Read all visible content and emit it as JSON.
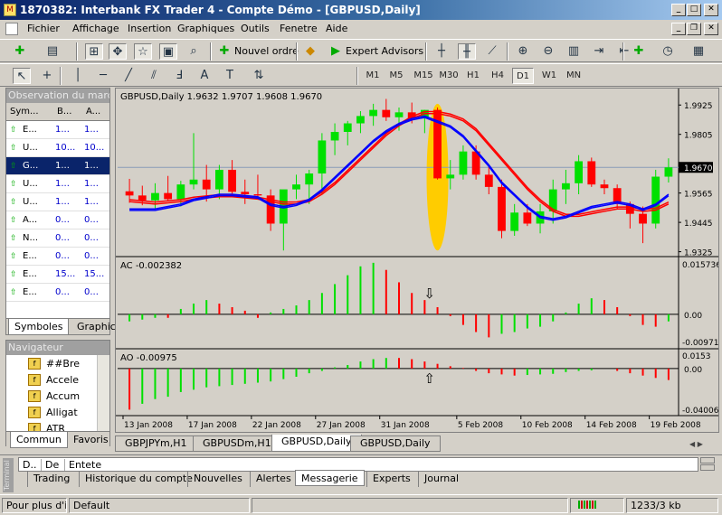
{
  "window": {
    "title": "1870382: Interbank FX Trader 4 - Compte Démo - [GBPUSD,Daily]"
  },
  "menu": [
    "Fichier",
    "Affichage",
    "Insertion",
    "Graphiques",
    "Outils",
    "Fenetre",
    "Aide"
  ],
  "toolbar": {
    "new_order": "Nouvel ordre",
    "expert_advisors": "Expert Advisors"
  },
  "timeframes": [
    "M1",
    "M5",
    "M15",
    "M30",
    "H1",
    "H4",
    "D1",
    "W1",
    "MN"
  ],
  "timeframe_selected": "D1",
  "market_watch": {
    "title": "Observation du marché",
    "columns": [
      "Sym...",
      "B...",
      "A..."
    ],
    "rows": [
      {
        "symbol": "E...",
        "bid": "1...",
        "ask": "1..."
      },
      {
        "symbol": "U...",
        "bid": "10...",
        "ask": "10..."
      },
      {
        "symbol": "G...",
        "bid": "1...",
        "ask": "1...",
        "selected": true
      },
      {
        "symbol": "U...",
        "bid": "1...",
        "ask": "1..."
      },
      {
        "symbol": "U...",
        "bid": "1...",
        "ask": "1..."
      },
      {
        "symbol": "A...",
        "bid": "0...",
        "ask": "0..."
      },
      {
        "symbol": "N...",
        "bid": "0...",
        "ask": "0..."
      },
      {
        "symbol": "E...",
        "bid": "0...",
        "ask": "0..."
      },
      {
        "symbol": "E...",
        "bid": "15...",
        "ask": "15..."
      },
      {
        "symbol": "E...",
        "bid": "0...",
        "ask": "0..."
      }
    ],
    "tabs": [
      "Symboles",
      "Graphic"
    ]
  },
  "navigator": {
    "title": "Navigateur",
    "items": [
      "##Bre",
      "Accele",
      "Accum",
      "Alligat",
      "ATR"
    ],
    "tabs": [
      "Commun",
      "Favoris"
    ]
  },
  "chart": {
    "header": "GBPUSD,Daily  1.9632 1.9707 1.9608 1.9670",
    "price_ticks": [
      "1.9925",
      "1.9805",
      "1.9565",
      "1.9445",
      "1.9325"
    ],
    "current_price": "1.9670",
    "ac_label": "AC -0.002382",
    "ac_ticks": [
      "0.015736",
      "0.00",
      "-0.00971"
    ],
    "ao_label": "AO -0.00975",
    "ao_ticks": [
      "0.0153",
      "0.00",
      "-0.04006"
    ],
    "dates": [
      "13 Jan 2008",
      "17 Jan 2008",
      "22 Jan 2008",
      "27 Jan 2008",
      "31 Jan 2008",
      "5 Feb 2008",
      "10 Feb 2008",
      "14 Feb 2008",
      "19 Feb 2008"
    ],
    "colors": {
      "up": "#00e000",
      "down": "#ff0000",
      "bg": "#d4d0c8",
      "ma_fast": "#0000ff",
      "ma_slow": "#ff0000",
      "highlight": "#ffcc00"
    }
  },
  "chart_data": {
    "type": "candlestick",
    "ohlc": [
      [
        1.9572,
        1.9623,
        1.9525,
        1.9555
      ],
      [
        1.9555,
        1.9595,
        1.9515,
        1.9535
      ],
      [
        1.9535,
        1.9605,
        1.95,
        1.9565
      ],
      [
        1.9565,
        1.9635,
        1.9535,
        1.954
      ],
      [
        1.954,
        1.9615,
        1.951,
        1.96
      ],
      [
        1.96,
        1.981,
        1.958,
        1.962
      ],
      [
        1.962,
        1.968,
        1.953,
        1.958
      ],
      [
        1.958,
        1.968,
        1.954,
        1.966
      ],
      [
        1.966,
        1.97,
        1.956,
        1.957
      ],
      [
        1.957,
        1.962,
        1.952,
        1.956
      ],
      [
        1.956,
        1.964,
        1.954,
        1.9555
      ],
      [
        1.9555,
        1.958,
        1.941,
        1.944
      ],
      [
        1.944,
        1.956,
        1.933,
        1.958
      ],
      [
        1.958,
        1.964,
        1.954,
        1.96
      ],
      [
        1.96,
        1.966,
        1.952,
        1.9645
      ],
      [
        1.9645,
        1.981,
        1.956,
        1.978
      ],
      [
        1.978,
        1.985,
        1.972,
        1.9815
      ],
      [
        1.9815,
        1.986,
        1.976,
        1.985
      ],
      [
        1.985,
        1.99,
        1.981,
        1.988
      ],
      [
        1.988,
        1.993,
        1.984,
        1.9905
      ],
      [
        1.9905,
        1.995,
        1.986,
        1.9875
      ],
      [
        1.9875,
        1.9915,
        1.982,
        1.9895
      ],
      [
        1.9895,
        1.9935,
        1.985,
        1.987
      ],
      [
        1.987,
        1.9905,
        1.981,
        1.9905
      ],
      [
        1.9905,
        1.9915,
        1.962,
        1.9625
      ],
      [
        1.9625,
        1.97,
        1.958,
        1.964
      ],
      [
        1.964,
        1.976,
        1.962,
        1.9735
      ],
      [
        1.9735,
        1.976,
        1.962,
        1.964
      ],
      [
        1.964,
        1.968,
        1.956,
        1.959
      ],
      [
        1.959,
        1.962,
        1.938,
        1.941
      ],
      [
        1.941,
        1.952,
        1.939,
        1.9485
      ],
      [
        1.9485,
        1.952,
        1.943,
        1.944
      ],
      [
        1.944,
        1.952,
        1.94,
        1.949
      ],
      [
        1.949,
        1.962,
        1.944,
        1.958
      ],
      [
        1.958,
        1.966,
        1.952,
        1.9605
      ],
      [
        1.9605,
        1.972,
        1.956,
        1.9695
      ],
      [
        1.9695,
        1.971,
        1.959,
        1.96
      ],
      [
        1.96,
        1.962,
        1.956,
        1.9585
      ],
      [
        1.9585,
        1.96,
        1.95,
        1.952
      ],
      [
        1.952,
        1.953,
        1.942,
        1.948
      ],
      [
        1.948,
        1.951,
        1.936,
        1.944
      ],
      [
        1.944,
        1.966,
        1.942,
        1.9632
      ],
      [
        1.9632,
        1.9707,
        1.9608,
        1.967
      ]
    ],
    "ma_fast": [
      1.95,
      1.95,
      1.95,
      1.951,
      1.952,
      1.954,
      1.955,
      1.956,
      1.956,
      1.9555,
      1.955,
      1.952,
      1.951,
      1.952,
      1.954,
      1.958,
      1.963,
      1.968,
      1.973,
      1.978,
      1.982,
      1.985,
      1.987,
      1.988,
      1.986,
      1.984,
      1.98,
      1.974,
      1.968,
      1.961,
      1.956,
      1.951,
      1.947,
      1.946,
      1.947,
      1.949,
      1.951,
      1.952,
      1.953,
      1.952,
      1.95,
      1.952,
      1.956
    ],
    "ma_slow": [
      1.953,
      1.9525,
      1.952,
      1.9525,
      1.953,
      1.954,
      1.9545,
      1.955,
      1.955,
      1.9545,
      1.954,
      1.953,
      1.952,
      1.952,
      1.953,
      1.956,
      1.96,
      1.965,
      1.97,
      1.975,
      1.98,
      1.984,
      1.987,
      1.989,
      1.989,
      1.988,
      1.986,
      1.982,
      1.976,
      1.97,
      1.964,
      1.958,
      1.953,
      1.949,
      1.947,
      1.947,
      1.948,
      1.949,
      1.95,
      1.95,
      1.949,
      1.9495,
      1.952
    ],
    "ac": [
      -0.002,
      -0.0015,
      -0.001,
      -0.001,
      0.0015,
      0.003,
      0.004,
      0.003,
      0.002,
      0.001,
      -0.001,
      0.0005,
      0.0015,
      0.0025,
      0.004,
      0.006,
      0.0085,
      0.011,
      0.0135,
      0.0145,
      0.0125,
      0.009,
      0.006,
      0.004,
      0.002,
      -0.0005,
      -0.003,
      -0.005,
      -0.0065,
      -0.0055,
      -0.005,
      -0.004,
      -0.0035,
      -0.002,
      0.0005,
      0.003,
      0.0045,
      0.004,
      0.002,
      -0.0005,
      -0.003,
      -0.0035,
      -0.002
    ],
    "ao": [
      -0.035,
      -0.03,
      -0.026,
      -0.024,
      -0.02,
      -0.018,
      -0.016,
      -0.015,
      -0.014,
      -0.013,
      -0.012,
      -0.011,
      -0.009,
      -0.007,
      -0.004,
      -0.002,
      0.001,
      0.003,
      0.006,
      0.008,
      0.009,
      0.009,
      0.008,
      0.006,
      0.004,
      0.002,
      0.0005,
      -0.002,
      -0.004,
      -0.005,
      -0.006,
      -0.0055,
      -0.005,
      -0.0045,
      -0.003,
      -0.002,
      -0.0015,
      0.0,
      -0.002,
      -0.004,
      -0.006,
      -0.008,
      -0.00975
    ],
    "ylim": [
      1.9305,
      1.9985
    ],
    "ac_lim": [
      -0.00971,
      0.015736
    ],
    "ao_lim": [
      -0.04006,
      0.0153
    ]
  },
  "chart_tabs": [
    "GBPJPYm,H1",
    "GBPUSDm,H1",
    "GBPUSD,Daily",
    "GBPUSD,Daily"
  ],
  "chart_tab_active": 2,
  "terminal": {
    "columns": [
      "D..",
      "De",
      "Entete"
    ],
    "side_label": "Terminal",
    "tabs": [
      "Trading",
      "Historique du compte",
      "Nouvelles",
      "Alertes",
      "Messagerie",
      "Experts",
      "Journal"
    ],
    "active_tab": "Messagerie"
  },
  "status": {
    "help": "Pour plus d'inf",
    "profile": "Default",
    "traffic": "1233/3 kb"
  }
}
